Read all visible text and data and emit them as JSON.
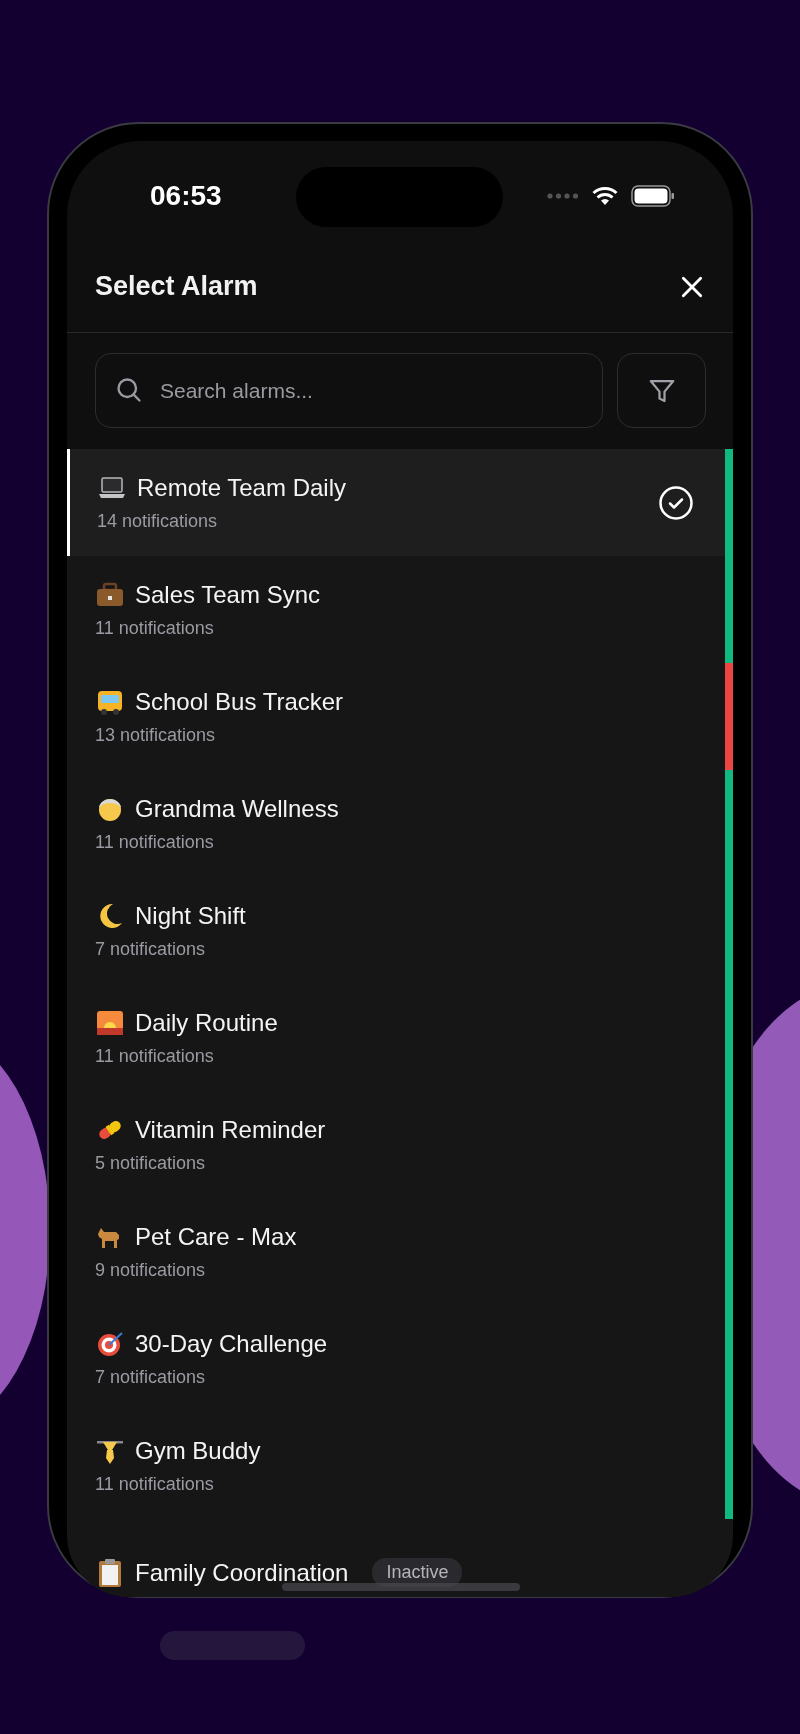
{
  "status_bar": {
    "time": "06:53"
  },
  "header": {
    "title": "Select Alarm"
  },
  "search": {
    "placeholder": "Search alarms..."
  },
  "alarms": [
    {
      "name": "Remote Team Daily",
      "count": "14 notifications",
      "selected": true,
      "color": "#10b981"
    },
    {
      "name": "Sales Team Sync",
      "count": "11 notifications",
      "selected": false,
      "color": "#10b981"
    },
    {
      "name": "School Bus Tracker",
      "count": "13 notifications",
      "selected": false,
      "color": "#ef4444"
    },
    {
      "name": "Grandma Wellness",
      "count": "11 notifications",
      "selected": false,
      "color": "#10b981"
    },
    {
      "name": "Night Shift",
      "count": "7 notifications",
      "selected": false,
      "color": "#10b981"
    },
    {
      "name": "Daily Routine",
      "count": "11 notifications",
      "selected": false,
      "color": "#10b981"
    },
    {
      "name": "Vitamin Reminder",
      "count": "5 notifications",
      "selected": false,
      "color": "#10b981"
    },
    {
      "name": "Pet Care - Max",
      "count": "9 notifications",
      "selected": false,
      "color": "#10b981"
    },
    {
      "name": "30-Day Challenge",
      "count": "7 notifications",
      "selected": false,
      "color": "#10b981"
    },
    {
      "name": "Gym Buddy",
      "count": "11 notifications",
      "selected": false,
      "color": "#10b981"
    },
    {
      "name": "Family Coordination",
      "selected": false,
      "badge": "Inactive"
    }
  ]
}
